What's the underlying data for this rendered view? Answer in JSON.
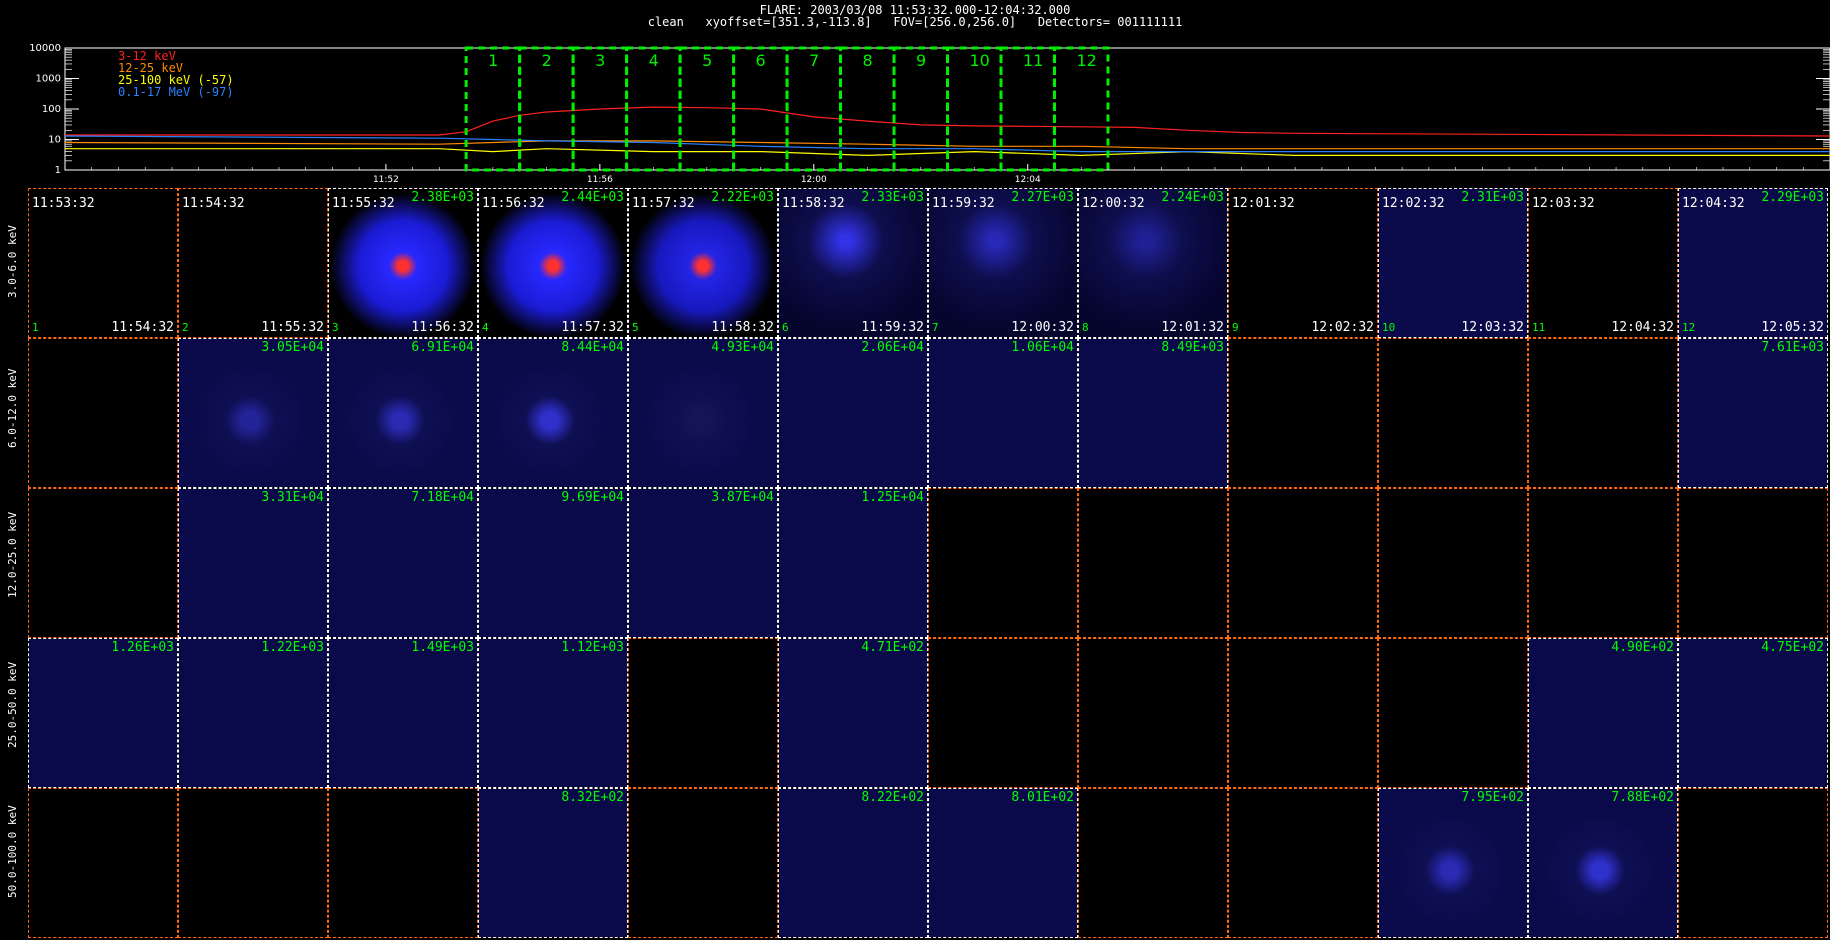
{
  "header": {
    "title": "FLARE: 2003/03/08 11:53:32.000-12:04:32.000",
    "subtitle": "clean   xyoffset=[351.3,-113.8]   FOV=[256.0,256.0]   Detectors= 001111111"
  },
  "colors": {
    "bg": "#000000",
    "grid_orange": "#ff6a10",
    "grid_white": "#ffffff",
    "interval": "#00ee00",
    "label_green": "#00ff00",
    "series_3_12": "#ff2020",
    "series_12_25": "#ff8a00",
    "series_25_100": "#ffff00",
    "series_01_17": "#2a82ff",
    "image_base": "#0a0a4a",
    "image_source": "#2a2aff",
    "image_core": "#ff3030"
  },
  "chart_data": [
    {
      "type": "line",
      "title": "",
      "ylabel": "",
      "y_scale": "log",
      "ylim": [
        1,
        10000
      ],
      "y_ticks": [
        "10000",
        "1000",
        "100",
        "10",
        "1"
      ],
      "x_range_min": [
        -6,
        27
      ],
      "x_tick_labels": [
        {
          "t": 0,
          "label": "11:52"
        },
        {
          "t": 4,
          "label": "11:56"
        },
        {
          "t": 8,
          "label": "12:00"
        },
        {
          "t": 12,
          "label": "12:04"
        }
      ],
      "grid": false,
      "legend_position": "top-left",
      "intervals": [
        "1",
        "2",
        "3",
        "4",
        "5",
        "6",
        "7",
        "8",
        "9",
        "10",
        "11",
        "12"
      ],
      "interval_start_min": 1.5,
      "interval_width_min": 1,
      "series": [
        {
          "name": "3-12 keV",
          "color": "#ff2020",
          "t": [
            -6,
            1,
            1.5,
            2,
            2.5,
            3,
            4,
            5,
            6,
            7,
            8,
            9,
            10,
            11,
            12,
            13,
            14,
            15,
            16,
            17,
            27
          ],
          "y": [
            14,
            14,
            18,
            40,
            62,
            80,
            100,
            115,
            110,
            100,
            55,
            40,
            30,
            28,
            27,
            26,
            25,
            20,
            17,
            16,
            13
          ]
        },
        {
          "name": "12-25 keV",
          "color": "#ff8a00",
          "t": [
            -6,
            1,
            2,
            3,
            5,
            7,
            9,
            11,
            13,
            15,
            17,
            27
          ],
          "y": [
            8,
            7,
            8,
            9,
            9,
            8,
            7,
            6,
            6,
            5,
            5,
            5
          ]
        },
        {
          "name": "25-100 keV (-57)",
          "color": "#ffff00",
          "t": [
            -6,
            1,
            2,
            3,
            5,
            7,
            9,
            11,
            13,
            15,
            17,
            27
          ],
          "y": [
            5,
            5,
            4,
            5,
            4,
            4,
            3,
            4,
            3,
            4,
            3,
            3
          ]
        },
        {
          "name": "0.1-17 MeV (-97)",
          "color": "#2a82ff",
          "t": [
            -6,
            1,
            2,
            3,
            5,
            7,
            9,
            11,
            13,
            15,
            17,
            27
          ],
          "y": [
            13,
            11,
            10,
            9,
            8,
            6,
            5,
            5,
            4,
            4,
            4,
            4
          ]
        }
      ]
    },
    {
      "type": "heatmap",
      "title": "",
      "rows": [
        "3.0-6.0 keV",
        "6.0-12.0 keV",
        "12.0-25.0 keV",
        "25.0-50.0 keV",
        "50.0-100.0 keV"
      ],
      "columns": [
        {
          "n": "1",
          "start": "11:53:32",
          "end": "11:54:32"
        },
        {
          "n": "2",
          "start": "11:54:32",
          "end": "11:55:32"
        },
        {
          "n": "3",
          "start": "11:55:32",
          "end": "11:56:32"
        },
        {
          "n": "4",
          "start": "11:56:32",
          "end": "11:57:32"
        },
        {
          "n": "5",
          "start": "11:57:32",
          "end": "11:58:32"
        },
        {
          "n": "6",
          "start": "11:58:32",
          "end": "11:59:32"
        },
        {
          "n": "7",
          "start": "11:59:32",
          "end": "12:00:32"
        },
        {
          "n": "8",
          "start": "12:00:32",
          "end": "12:01:32"
        },
        {
          "n": "9",
          "start": "12:01:32",
          "end": "12:02:32"
        },
        {
          "n": "10",
          "start": "12:02:32",
          "end": "12:03:32"
        },
        {
          "n": "11",
          "start": "12:03:32",
          "end": "12:04:32"
        },
        {
          "n": "12",
          "start": "12:04:32",
          "end": "12:05:32"
        }
      ],
      "peaks": [
        [
          "",
          "",
          "2.38E+03",
          "2.44E+03",
          "2.22E+03",
          "2.33E+03",
          "2.27E+03",
          "2.24E+03",
          "",
          "2.31E+03",
          "",
          "2.29E+03"
        ],
        [
          "",
          "3.05E+04",
          "6.91E+04",
          "8.44E+04",
          "4.93E+04",
          "2.06E+04",
          "1.06E+04",
          "8.49E+03",
          "",
          "",
          "",
          "7.61E+03"
        ],
        [
          "",
          "3.31E+04",
          "7.18E+04",
          "9.69E+04",
          "3.87E+04",
          "1.25E+04",
          "",
          "",
          "",
          "",
          "",
          ""
        ],
        [
          "1.26E+03",
          "1.22E+03",
          "1.49E+03",
          "1.12E+03",
          "",
          "4.71E+02",
          "",
          "",
          "",
          "",
          "4.90E+02",
          "4.75E+02"
        ],
        [
          "",
          "",
          "",
          "8.32E+02",
          "",
          "8.22E+02",
          "8.01E+02",
          "",
          "",
          "7.95E+02",
          "7.88E+02",
          ""
        ]
      ],
      "render": [
        [
          "none",
          "none",
          "full",
          "full",
          "full",
          "faint",
          "faint",
          "faint",
          "none",
          "dim",
          "none",
          "dim"
        ],
        [
          "none",
          "dim",
          "dim",
          "dim",
          "dim",
          "dim",
          "dim",
          "dim",
          "none",
          "none",
          "none",
          "dim"
        ],
        [
          "none",
          "dim",
          "dim",
          "dim",
          "dim",
          "dim",
          "none",
          "none",
          "none",
          "none",
          "none",
          "none"
        ],
        [
          "dim",
          "dim",
          "dim",
          "dim",
          "none",
          "dim",
          "none",
          "none",
          "none",
          "none",
          "dim",
          "dim"
        ],
        [
          "none",
          "none",
          "none",
          "dim",
          "none",
          "dim",
          "dim",
          "none",
          "none",
          "dim",
          "dim",
          "none"
        ]
      ],
      "source_intensity": [
        [
          0,
          0,
          1,
          1,
          0.9,
          0.6,
          0.3,
          0.15,
          0,
          0,
          0,
          0
        ],
        [
          0,
          0.6,
          0.7,
          0.8,
          0.35,
          0,
          0,
          0,
          0,
          0,
          0,
          0
        ],
        [
          0,
          0,
          0,
          0,
          0,
          0,
          0,
          0,
          0,
          0,
          0,
          0
        ],
        [
          0,
          0,
          0,
          0,
          0,
          0,
          0,
          0,
          0,
          0,
          0,
          0
        ],
        [
          0,
          0,
          0,
          0,
          0,
          0,
          0,
          0,
          0,
          0.7,
          0.8,
          0
        ]
      ]
    }
  ]
}
